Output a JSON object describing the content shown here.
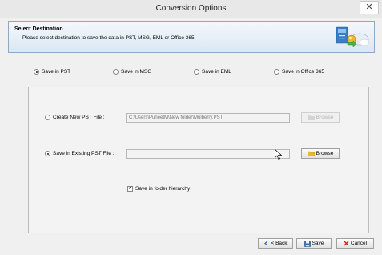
{
  "window": {
    "title": "Conversion Options",
    "close_glyph": "✕"
  },
  "header": {
    "title": "Select Destination",
    "description": "Please select destination to save the data in PST, MSG, EML or Office 365."
  },
  "save_options": {
    "selected": "pst",
    "items": [
      {
        "id": "pst",
        "label": "Save in PST"
      },
      {
        "id": "msg",
        "label": "Save in MSG"
      },
      {
        "id": "eml",
        "label": "Save in EML"
      },
      {
        "id": "o365",
        "label": "Save in Office 365"
      }
    ]
  },
  "pst_options": {
    "create_new": {
      "label": "Create New PST File :",
      "path": "C:\\Users\\PuneetM\\New folder\\Mulberry.PST",
      "browse_label": "Browse",
      "selected": false
    },
    "existing": {
      "label": "Save in Existing PST File :",
      "path": "",
      "browse_label": "Browse",
      "selected": true
    },
    "folder_hierarchy": {
      "label": "Save in folder hierarchy",
      "checked": true
    }
  },
  "footer": {
    "back_label": "< Back",
    "save_label": "Save",
    "cancel_label": "Cancel"
  },
  "colors": {
    "accent_blue": "#2f6fb4",
    "cancel_red": "#d02020",
    "folder_yellow": "#e8b830"
  }
}
